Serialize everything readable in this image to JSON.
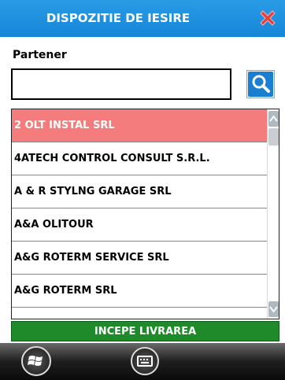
{
  "window": {
    "title": "DISPOZITIE DE IESIRE"
  },
  "form": {
    "partner_label": "Partener",
    "partner_value": ""
  },
  "partners": [
    {
      "name": "2 OLT INSTAL SRL",
      "selected": true
    },
    {
      "name": "4ATECH CONTROL CONSULT S.R.L.",
      "selected": false
    },
    {
      "name": "A & R STYLNG GARAGE SRL",
      "selected": false
    },
    {
      "name": "A&A OLITOUR",
      "selected": false
    },
    {
      "name": "A&G ROTERM SERVICE SRL",
      "selected": false
    },
    {
      "name": "A&G ROTERM SRL",
      "selected": false
    }
  ],
  "actions": {
    "start_delivery": "INCEPE LIVRAREA"
  },
  "icons": {
    "close": "close-icon",
    "search": "search-icon",
    "windows": "windows-logo-icon",
    "keyboard": "keyboard-icon"
  },
  "colors": {
    "titlebar": "#1a8fe0",
    "selected_row": "#f47c7c",
    "start_button": "#1f8a2a",
    "close": "#e04040"
  }
}
